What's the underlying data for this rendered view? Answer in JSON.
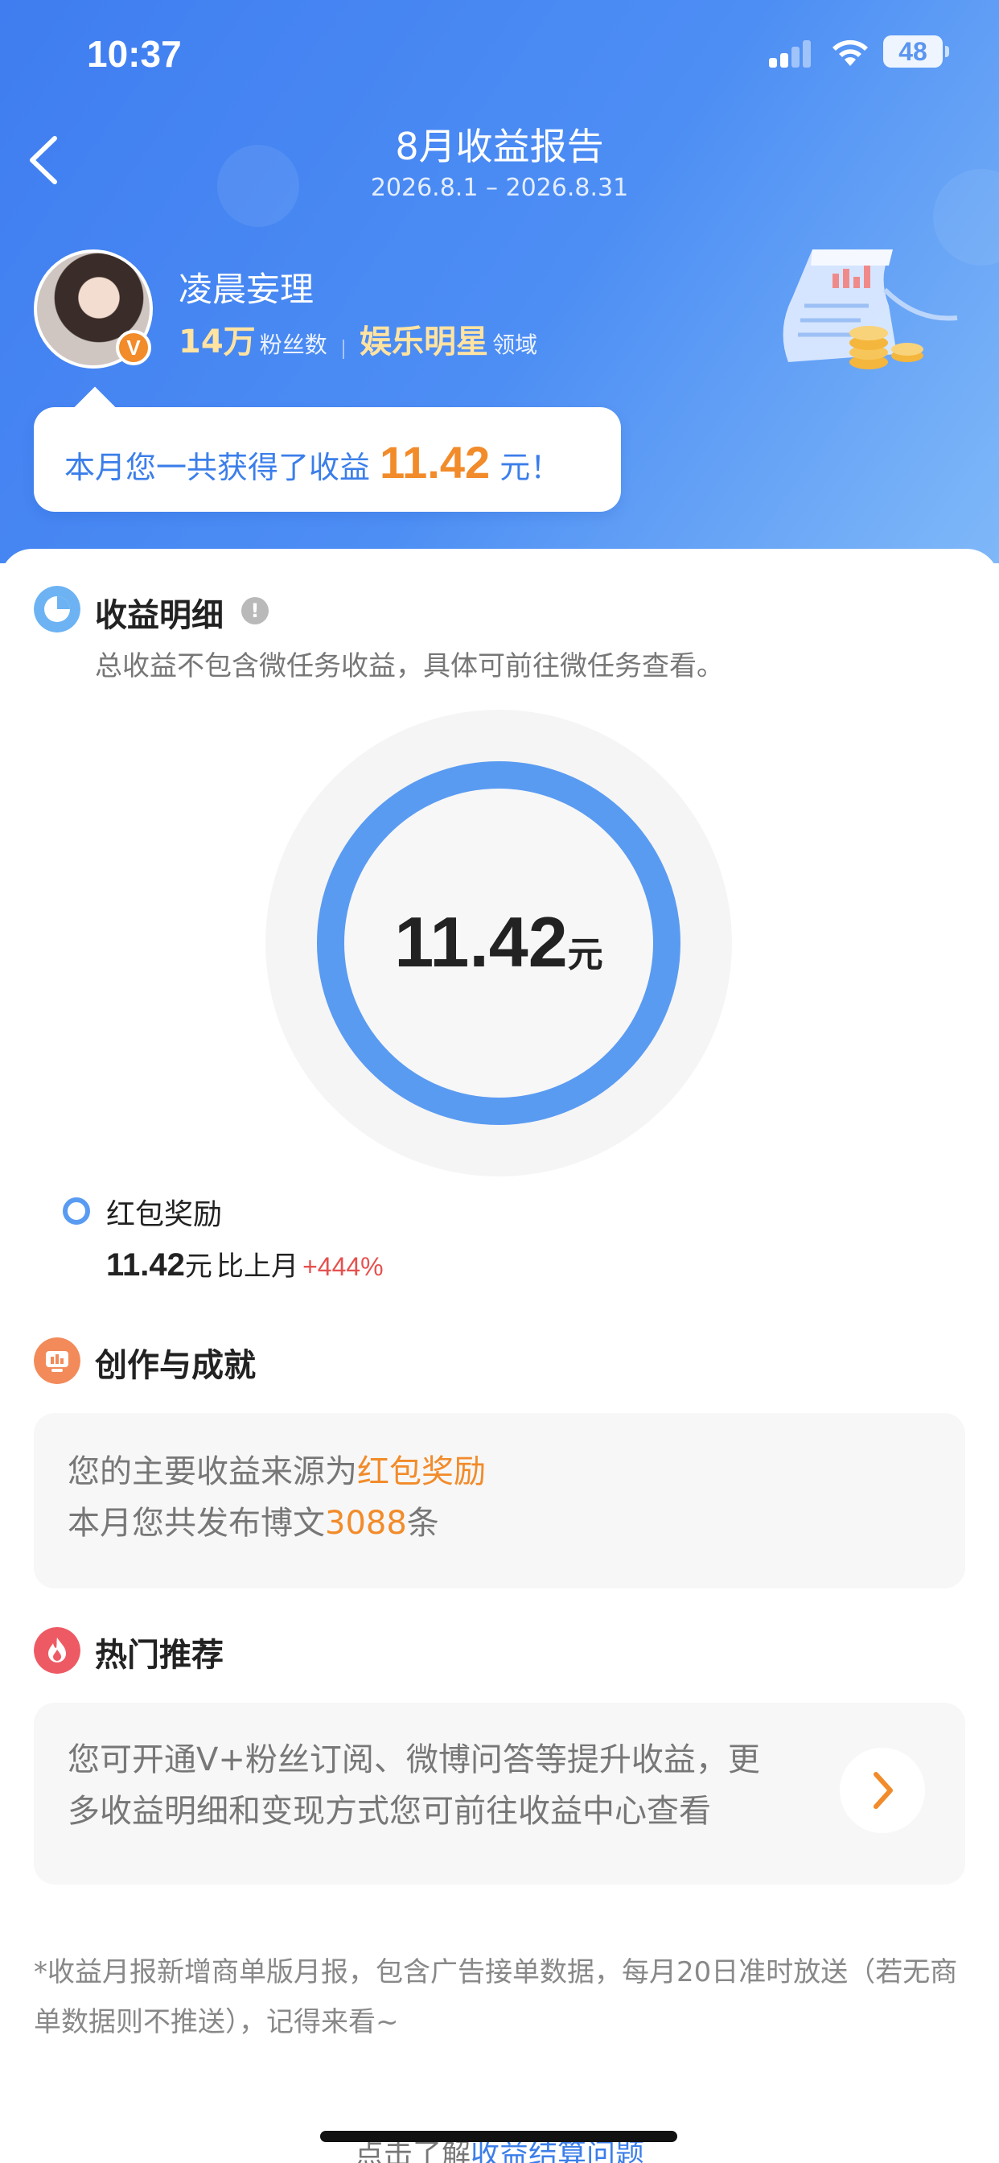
{
  "status_bar": {
    "time": "10:37",
    "battery": "48"
  },
  "header": {
    "title": "8月收益报告",
    "date_range": "2026.8.1 – 2026.8.31"
  },
  "profile": {
    "name": "凌晨妄理",
    "fans_count": "14万",
    "fans_label": "粉丝数",
    "field_name": "娱乐明星",
    "field_suffix": "领域",
    "badge": "V"
  },
  "earnings_bubble": {
    "prefix": "本月您一共获得了收益",
    "amount": "11.42",
    "suffix": "元！"
  },
  "income_detail": {
    "title": "收益明细",
    "note": "总收益不包含微任务收益，具体可前往微任务查看。",
    "total_value": "11.42",
    "total_unit": "元",
    "legend": {
      "label": "红包奖励",
      "value": "11.42",
      "unit": "元",
      "compare_label": "比上月",
      "change": "+444%"
    }
  },
  "creation": {
    "title": "创作与成就",
    "line1_prefix": "您的主要收益来源为",
    "line1_highlight": "红包奖励",
    "line2_prefix": "本月您共发布博文",
    "line2_highlight": "3088",
    "line2_suffix": "条"
  },
  "hot": {
    "title": "热门推荐",
    "line1": "您可开通V+粉丝订阅、微博问答等提升收益，更",
    "line2": "多收益明细和变现方式您可前往收益中心查看"
  },
  "footnote": "*收益月报新增商单版月报，包含广告接单数据，每月20日准时放送（若无商单数据则不推送），记得来看~",
  "bottom_link": {
    "prefix": "点击了解",
    "link": "收益结算问题"
  },
  "colors": {
    "primary_blue": "#4d8ef4",
    "ring_blue": "#5a9bf2",
    "accent_orange": "#f28b2a",
    "positive_red": "#e5514f"
  }
}
